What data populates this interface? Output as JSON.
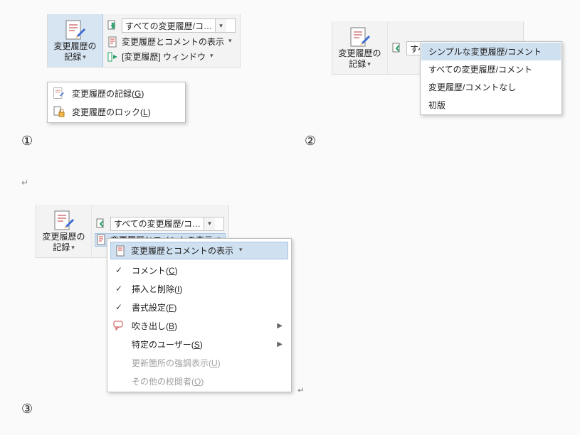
{
  "labels": {
    "track_changes": "変更履歴の",
    "track_changes_2": "記録",
    "row_show": "変更履歴とコメントの表示",
    "row_window": "[変更履歴] ウィンドウ"
  },
  "combo": {
    "selected": "すべての変更履歴/コ…"
  },
  "panel1_menu": [
    {
      "label": "変更履歴の記録(",
      "key": "G",
      "suffix": ")",
      "icon": "track-changes-icon"
    },
    {
      "label": "変更履歴のロック(",
      "key": "L",
      "suffix": ")",
      "icon": "lock-icon"
    }
  ],
  "panel2_options": [
    "シンプルな変更履歴/コメント",
    "すべての変更履歴/コメント",
    "変更履歴/コメントなし",
    "初版"
  ],
  "panel3_menu": {
    "header": "変更履歴とコメントの表示",
    "items": [
      {
        "label": "コメント(",
        "key": "C",
        "suffix": ")",
        "checked": true
      },
      {
        "label": "挿入と削除(",
        "key": "I",
        "suffix": ")",
        "checked": true
      },
      {
        "label": "書式設定(",
        "key": "F",
        "suffix": ")",
        "checked": true
      },
      {
        "label": "吹き出し(",
        "key": "B",
        "suffix": ")",
        "submenu": true,
        "icon": "balloon-icon"
      },
      {
        "label": "特定のユーザー(",
        "key": "S",
        "suffix": ")",
        "submenu": true
      },
      {
        "label": "更新箇所の強調表示(",
        "key": "U",
        "suffix": ")",
        "disabled": true
      },
      {
        "label": "その他の校閲者(",
        "key": "O",
        "suffix": ")",
        "disabled": true
      }
    ]
  },
  "circles": {
    "1": "①",
    "2": "②",
    "3": "③"
  },
  "markers": {
    "le": "↵"
  }
}
